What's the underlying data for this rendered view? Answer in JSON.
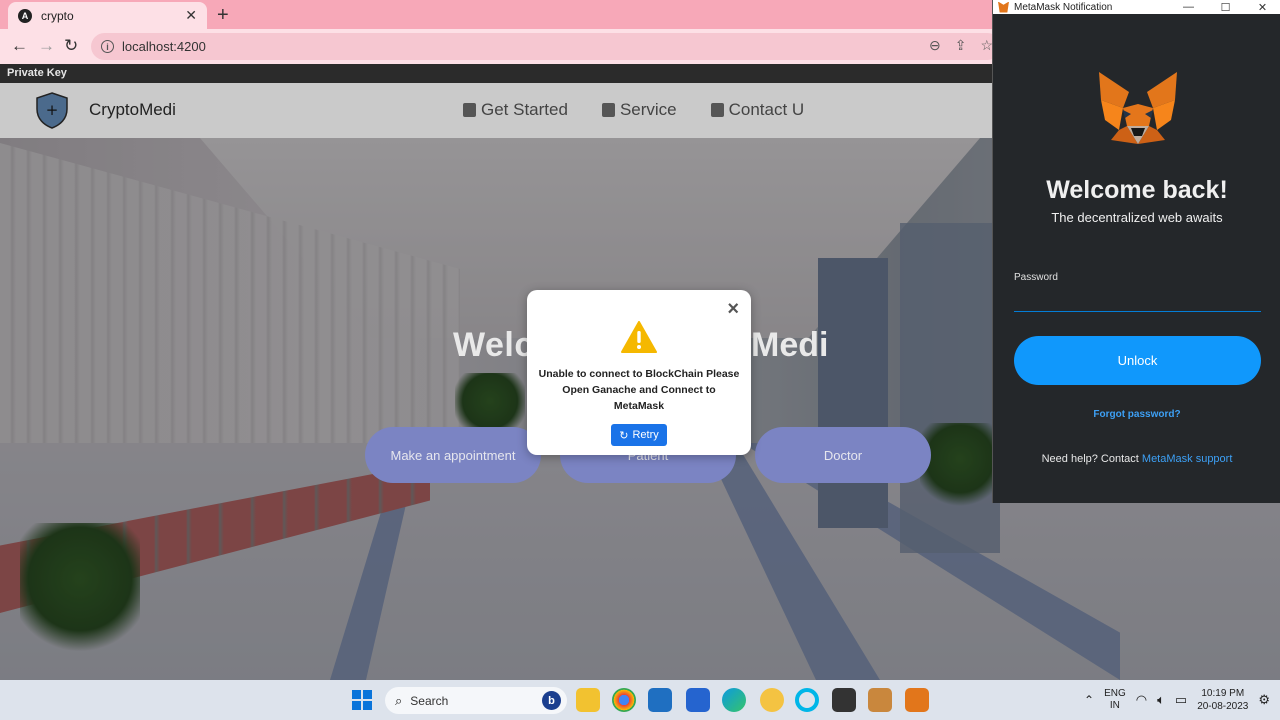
{
  "browser": {
    "tab_title": "crypto",
    "tab_favicon": "A",
    "url": "localhost:4200",
    "bookmark": "Private Key"
  },
  "site": {
    "brand": "CryptoMedi",
    "nav": [
      "Get Started",
      "Service",
      "Contact U"
    ],
    "hero_left": "Welc",
    "hero_right": "Medi",
    "buttons": [
      "Make an appointment",
      "Patient",
      "Doctor"
    ]
  },
  "modal": {
    "message": "Unable to connect to BlockChain Please Open Ganache and Connect to MetaMask",
    "retry_label": "Retry",
    "close": "×"
  },
  "metamask": {
    "window_title": "MetaMask Notification",
    "welcome": "Welcome back!",
    "subtitle": "The decentralized web awaits",
    "password_label": "Password",
    "unlock_label": "Unlock",
    "forgot_label": "Forgot password?",
    "help_text": "Need help? Contact",
    "help_link": "MetaMask support"
  },
  "taskbar": {
    "search_label": "Search",
    "lang_top": "ENG",
    "lang_bottom": "IN",
    "time": "10:19 PM",
    "date": "20-08-2023"
  },
  "colors": {
    "accent_blue": "#1a73e8",
    "metamask_blue": "#1098fc",
    "pill": "#7b84c3",
    "tab_pink": "#f7a8b8"
  }
}
